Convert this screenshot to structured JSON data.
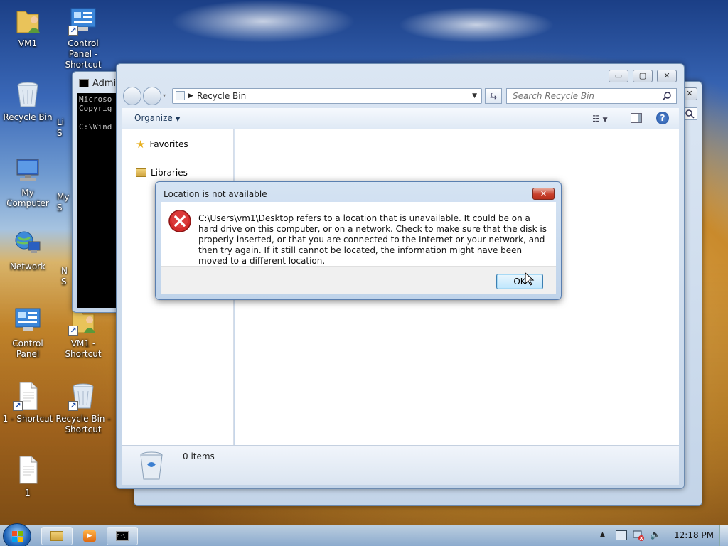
{
  "desktop": {
    "icons": [
      {
        "label": "VM1",
        "icon": "user-folder-icon"
      },
      {
        "label": "Control Panel - Shortcut",
        "icon": "control-panel-icon"
      },
      {
        "label": "Recycle Bin",
        "icon": "recycle-bin-icon"
      },
      {
        "label": "My Computer",
        "icon": "computer-icon"
      },
      {
        "label": "Network",
        "icon": "network-icon"
      },
      {
        "label": "Control Panel",
        "icon": "control-panel-icon"
      },
      {
        "label": "VM1 - Shortcut",
        "icon": "user-folder-icon"
      },
      {
        "label": "1 - Shortcut",
        "icon": "document-icon"
      },
      {
        "label": "Recycle Bin - Shortcut",
        "icon": "recycle-bin-icon"
      },
      {
        "label": "1",
        "icon": "document-icon"
      }
    ],
    "partial_labels": {
      "li": "Li",
      "s1": "S",
      "my": "My",
      "s2": "S",
      "n": "N",
      "s3": "S"
    }
  },
  "cmd_window": {
    "title": "Admin",
    "lines": [
      "Microso",
      "Copyrig",
      "",
      "C:\\Wind"
    ]
  },
  "explorer": {
    "address": "Recycle Bin",
    "search_placeholder": "Search Recycle Bin",
    "toolbar": {
      "organize": "Organize"
    },
    "nav": [
      {
        "label": "Favorites",
        "icon": "star-icon"
      },
      {
        "label": "Libraries",
        "icon": "libraries-icon"
      }
    ],
    "details": {
      "count": "0 items"
    }
  },
  "dialog": {
    "title": "Location is not available",
    "message": "C:\\Users\\vm1\\Desktop refers to a location that is unavailable. It could be on a hard drive on this computer, or on a network. Check to make sure that the disk is properly inserted, or that you are connected to the Internet or your network, and then try again. If it still cannot be located, the information might have been moved to a different location.",
    "ok_label": "OK",
    "icon": "error-icon"
  },
  "taskbar": {
    "time": "12:18 PM",
    "buttons": [
      "start-orb-icon",
      "explorer-icon",
      "media-player-icon",
      "cmd-icon"
    ]
  },
  "colors": {
    "accent": "#3c7fb1",
    "error": "#c8202a"
  }
}
